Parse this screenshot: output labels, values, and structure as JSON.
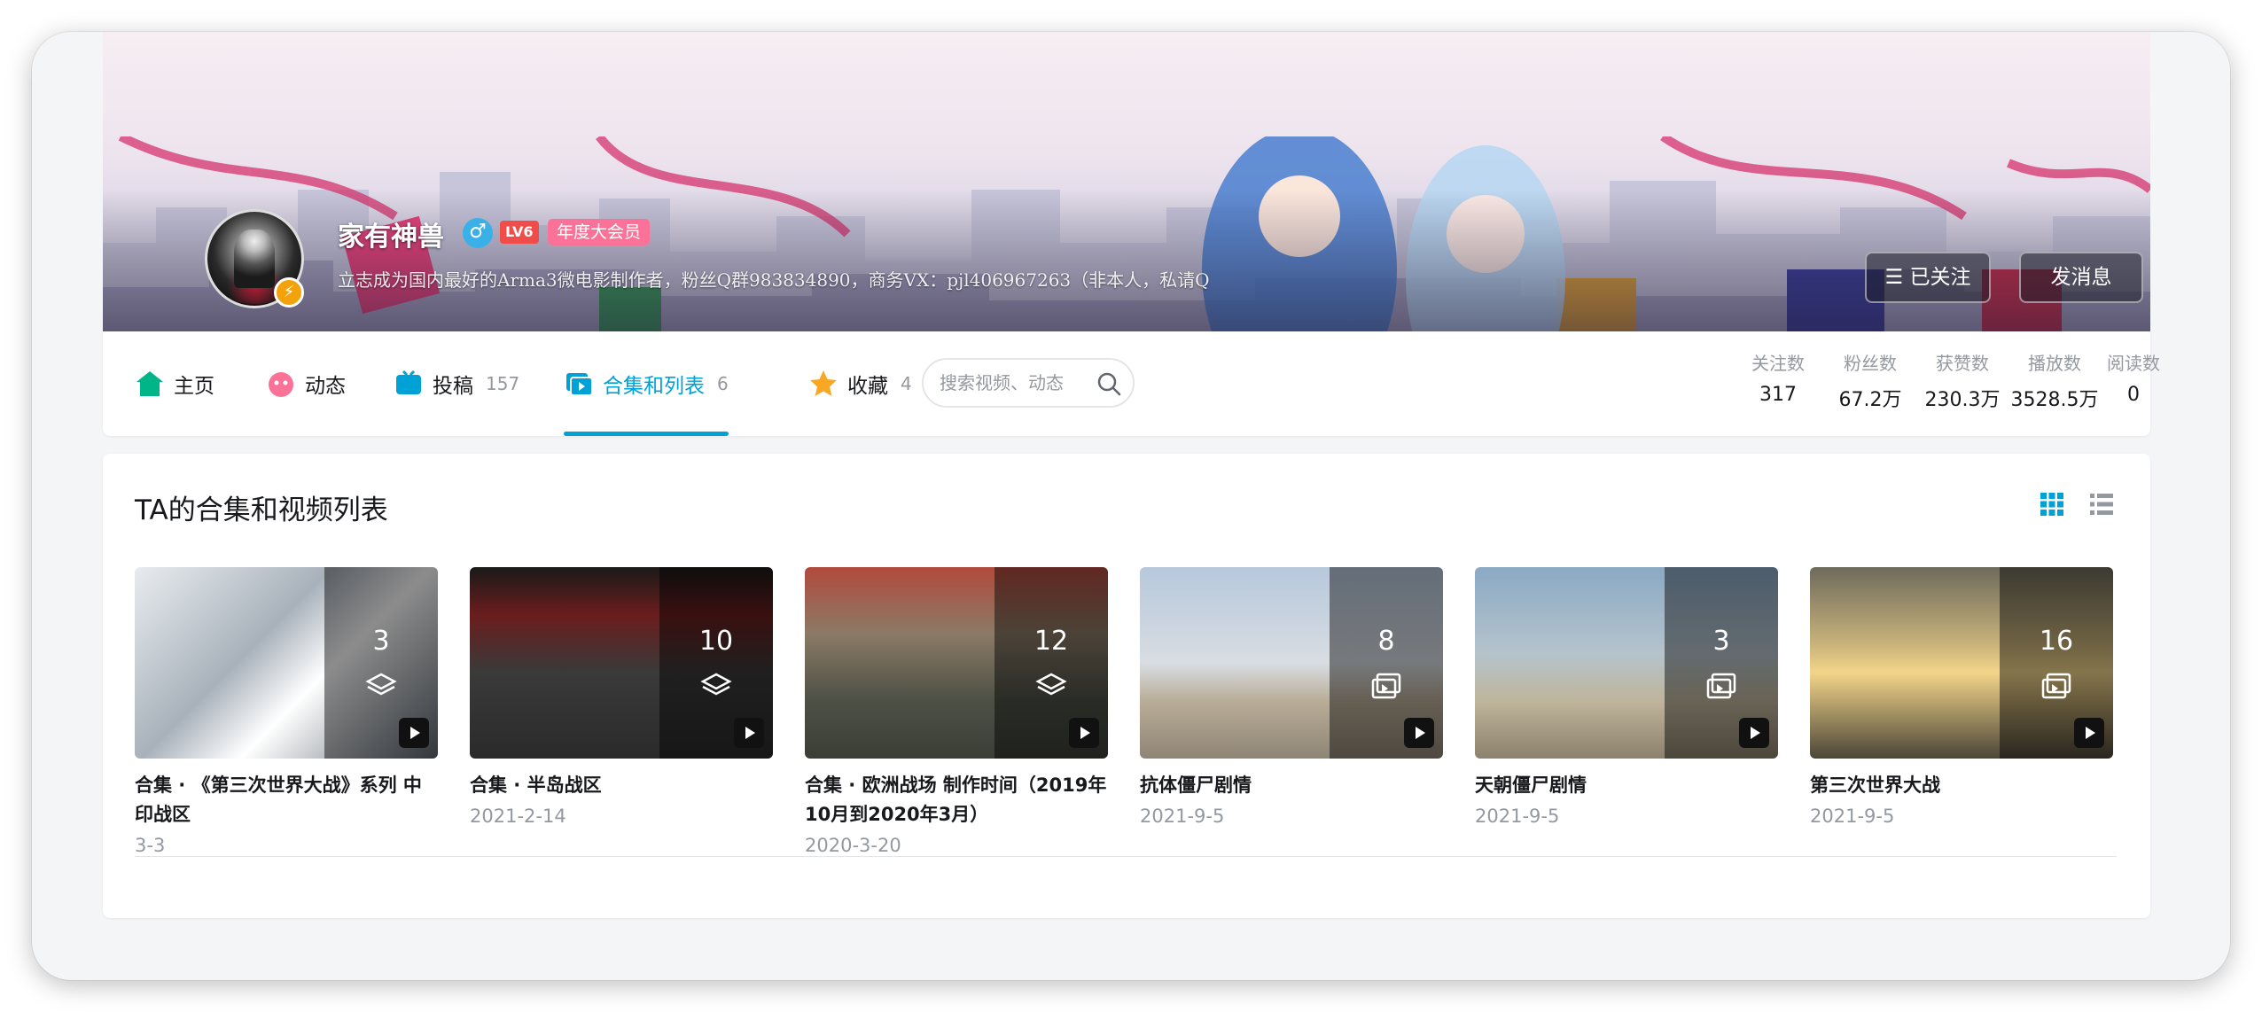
{
  "user": {
    "name": "家有神兽",
    "level": "LV6",
    "vip": "年度大会员",
    "sign": "立志成为国内最好的Arma3微电影制作者，粉丝Q群983834890，商务VX：pjl406967263（非本人，私请Q"
  },
  "actions": {
    "follow_label": "☰ 已关注",
    "message_label": "发消息"
  },
  "nav": {
    "tabs": [
      {
        "label": "主页",
        "count": ""
      },
      {
        "label": "动态",
        "count": ""
      },
      {
        "label": "投稿",
        "count": "157"
      },
      {
        "label": "合集和列表",
        "count": "6"
      },
      {
        "label": "收藏",
        "count": "4"
      }
    ],
    "search_placeholder": "搜索视频、动态"
  },
  "stats": [
    {
      "label": "关注数",
      "value": "317"
    },
    {
      "label": "粉丝数",
      "value": "67.2万"
    },
    {
      "label": "获赞数",
      "value": "230.3万"
    },
    {
      "label": "播放数",
      "value": "3528.5万"
    },
    {
      "label": "阅读数",
      "value": "0"
    }
  ],
  "section": {
    "title": "TA的合集和视频列表"
  },
  "collections": [
    {
      "count": "3",
      "kind": "collection",
      "title": "合集 · 《第三次世界大战》系列 中印战区",
      "date": "3-3"
    },
    {
      "count": "10",
      "kind": "collection",
      "title": "合集 · 半岛战区",
      "date": "2021-2-14"
    },
    {
      "count": "12",
      "kind": "collection",
      "title": "合集 · 欧洲战场 制作时间（2019年10月到2020年3月）",
      "date": "2020-3-20"
    },
    {
      "count": "8",
      "kind": "list",
      "title": "抗体僵尸剧情",
      "date": "2021-9-5"
    },
    {
      "count": "3",
      "kind": "list",
      "title": "天朝僵尸剧情",
      "date": "2021-9-5"
    },
    {
      "count": "16",
      "kind": "list",
      "title": "第三次世界大战",
      "date": "2021-9-5"
    }
  ],
  "colors": {
    "accent": "#00a1d6",
    "vip": "#fb7299",
    "level": "#f04c49"
  }
}
